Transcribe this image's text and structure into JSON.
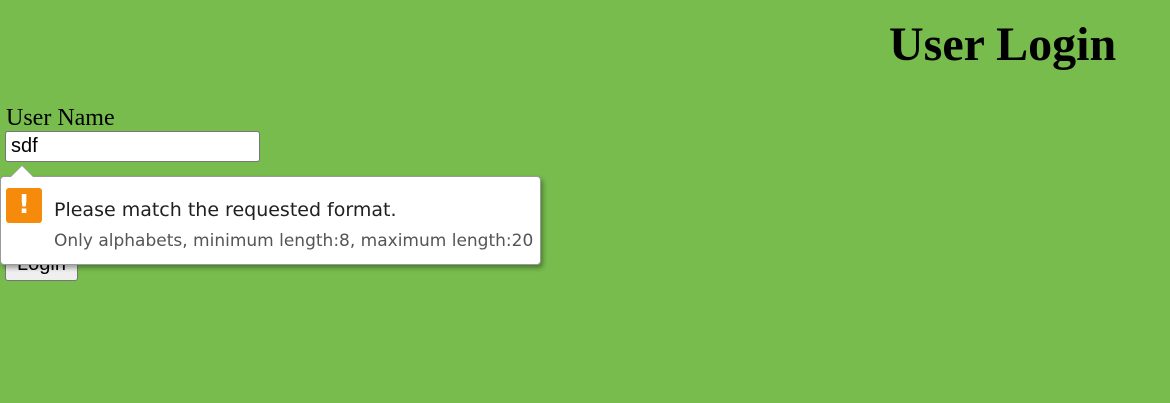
{
  "page": {
    "title": "User Login",
    "background_color": "#77bc4d"
  },
  "form": {
    "username_label": "User Name",
    "username_value": "sdf",
    "login_label": "Login"
  },
  "validation_tooltip": {
    "icon": "warning-icon",
    "icon_color": "#f58a0b",
    "icon_glyph": "!",
    "title": "Please match the requested format.",
    "detail": "Only alphabets, minimum length:8, maximum length:20"
  }
}
